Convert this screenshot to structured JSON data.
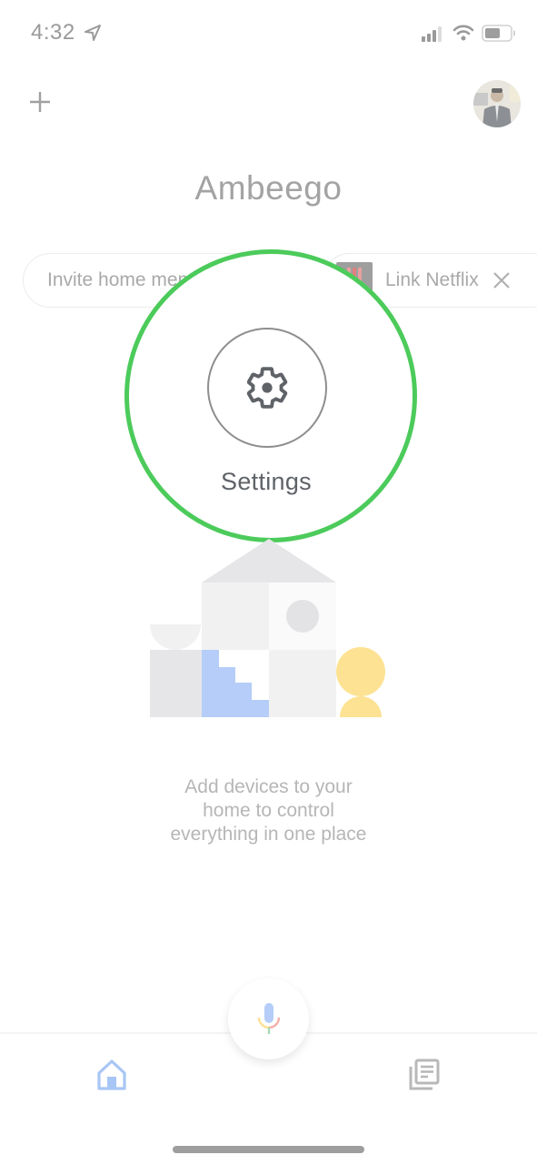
{
  "status_bar": {
    "time": "4:32",
    "icons": [
      "location-arrow-icon",
      "cellular-signal-icon",
      "wifi-icon",
      "battery-icon"
    ]
  },
  "header": {
    "add_icon": "plus-icon",
    "avatar_alt": "Profile photo",
    "home_name": "Ambeego"
  },
  "chips": [
    {
      "label": "Invite home members"
    },
    {
      "label": "Link Netflix",
      "icon": "netflix-logo",
      "dismiss_icon": "close-icon"
    }
  ],
  "highlight": {
    "label": "Settings",
    "icon": "gear-icon",
    "ring_color": "#4ccb5b"
  },
  "empty_state": {
    "lines": [
      "Add devices to your",
      "home to control",
      "everything in one place"
    ]
  },
  "bottom_nav": {
    "items": [
      {
        "name": "home",
        "icon": "home-icon",
        "active": true,
        "color": "#a8c6f5"
      },
      {
        "name": "feed",
        "icon": "feed-icon",
        "active": false,
        "color": "#b8b8b8"
      }
    ],
    "mic_icon": "microphone-icon"
  },
  "colors": {
    "accent_green": "#4ccb5b",
    "illustration_blue": "#b5cdf8",
    "illustration_yellow": "#fde293",
    "muted_text": "#a9a9a9"
  }
}
